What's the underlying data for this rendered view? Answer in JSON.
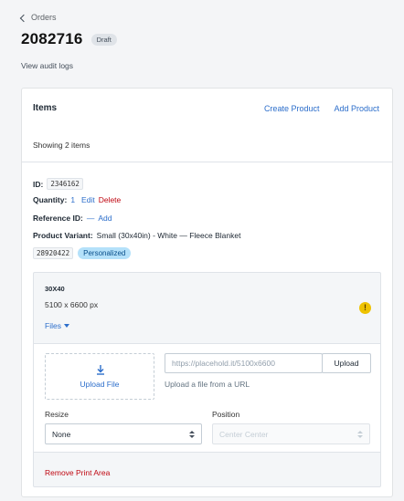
{
  "breadcrumb": {
    "label": "Orders"
  },
  "order": {
    "number": "2082716",
    "status": "Draft",
    "audit_link": "View audit logs"
  },
  "items_card": {
    "title": "Items",
    "actions": {
      "create_product": "Create Product",
      "add_product": "Add Product"
    },
    "showing": "Showing 2 items"
  },
  "item": {
    "id_label": "ID:",
    "id_value": "2346162",
    "quantity_label": "Quantity:",
    "quantity_value": "1",
    "edit": "Edit",
    "delete": "Delete",
    "reference_label": "Reference ID:",
    "reference_value": "—",
    "reference_add": "Add",
    "variant_label": "Product Variant:",
    "variant_value": "Small (30x40in) - White — Fleece Blanket",
    "variant_code": "28920422",
    "badge": "Personalized"
  },
  "print_area": {
    "name": "30X40",
    "dimensions": "5100 x 6600 px",
    "warning_glyph": "!",
    "files_toggle": "Files",
    "upload_file": "Upload File",
    "url_placeholder": "https://placehold.it/5100x6600",
    "upload_button": "Upload",
    "url_help": "Upload a file from a URL",
    "resize_label": "Resize",
    "resize_value": "None",
    "position_label": "Position",
    "position_value": "Center Center",
    "remove": "Remove Print Area"
  },
  "colors": {
    "link": "#2c6ecb",
    "danger": "#bf0711",
    "warning": "#eec200",
    "badge_personalized": "#b4e1fa"
  }
}
